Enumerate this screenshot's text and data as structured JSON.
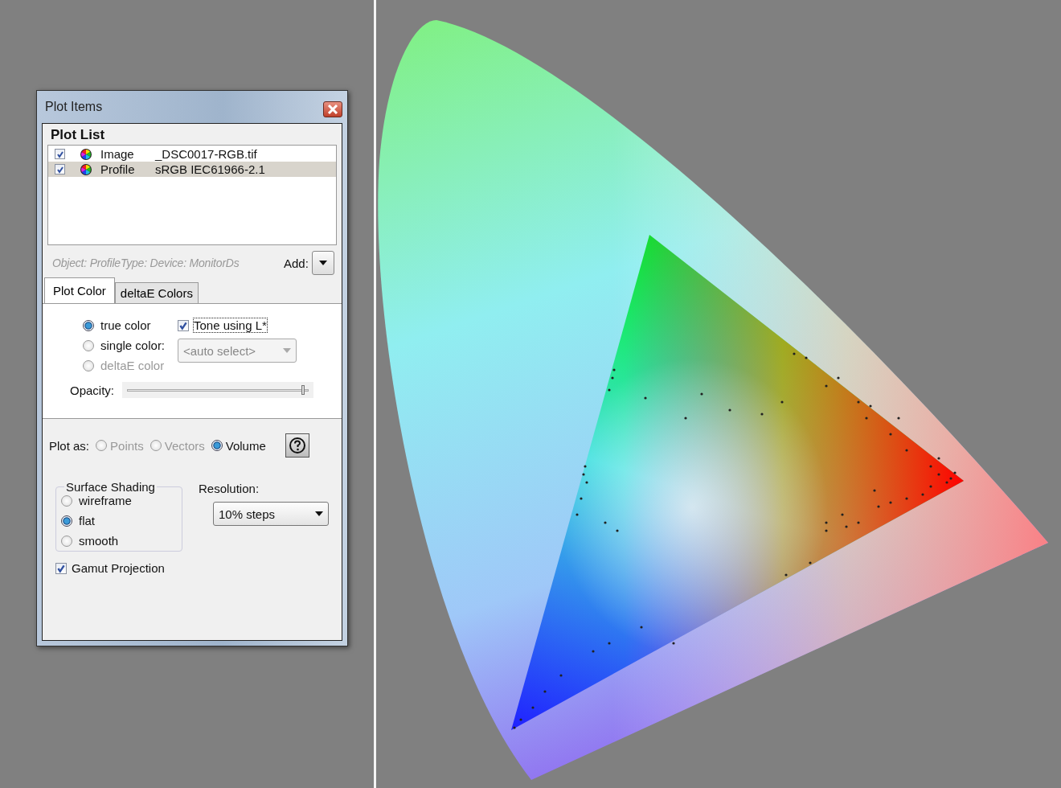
{
  "window": {
    "title": "Plot Items"
  },
  "plot_list": {
    "title": "Plot List",
    "items": [
      {
        "checked": true,
        "type": "Image",
        "name": "_DSC0017-RGB.tif",
        "selected": false
      },
      {
        "checked": true,
        "type": "Profile",
        "name": "sRGB IEC61966-2.1",
        "selected": true
      }
    ],
    "info": "Object: ProfileType: Device: MonitorDs",
    "add_label": "Add:"
  },
  "tabs": [
    {
      "label": "Plot Color",
      "selected": true
    },
    {
      "label": "deltaE Colors",
      "selected": false
    }
  ],
  "color_modes": [
    {
      "label": "true color",
      "selected": true,
      "disabled": false
    },
    {
      "label": "single color:",
      "selected": false,
      "disabled": false
    },
    {
      "label": "deltaE color",
      "selected": false,
      "disabled": true
    }
  ],
  "tone": {
    "label": "Tone using L*",
    "checked": true
  },
  "single_color_select": {
    "value": "<auto select>",
    "disabled": true
  },
  "opacity": {
    "label": "Opacity:",
    "level": 0.98
  },
  "plot_as": {
    "label": "Plot as:",
    "options": [
      {
        "label": "Points",
        "selected": false,
        "disabled": true
      },
      {
        "label": "Vectors",
        "selected": false,
        "disabled": true
      },
      {
        "label": "Volume",
        "selected": true,
        "disabled": false
      }
    ]
  },
  "surface_shading": {
    "title": "Surface Shading",
    "options": [
      {
        "label": "wireframe",
        "selected": false
      },
      {
        "label": "flat",
        "selected": true
      },
      {
        "label": "smooth",
        "selected": false
      }
    ]
  },
  "resolution": {
    "label": "Resolution:",
    "value": "10% steps"
  },
  "gamut_projection": {
    "label": "Gamut Projection",
    "checked": true
  }
}
